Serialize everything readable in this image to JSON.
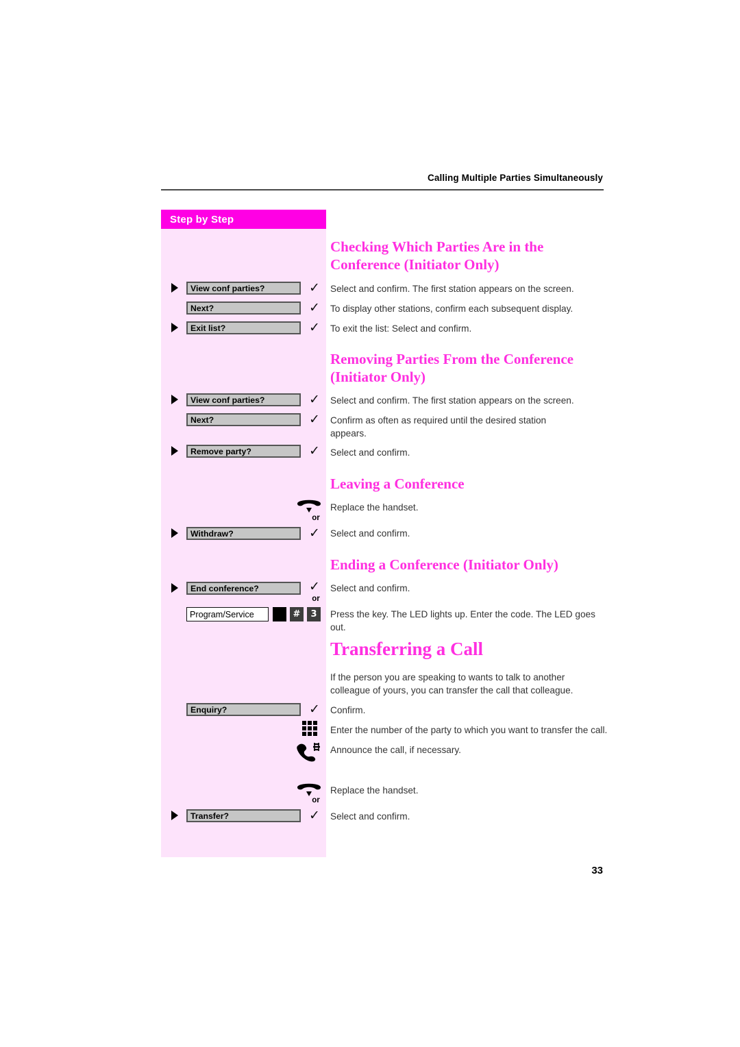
{
  "running_head": "Calling Multiple Parties Simultaneously",
  "sidebar": {
    "header_label": "Step by Step"
  },
  "page_number": "33",
  "colors": {
    "accent_magenta": "#ff00e4",
    "heading_magenta": "#ff2fe0",
    "sidebar_fill": "#fde3fb",
    "softkey_fill": "#c6c6c6",
    "softkey_border": "#555555"
  },
  "sections": [
    {
      "id": "checking-parties",
      "heading": "Checking Which Parties Are in the Conference (Initiator Only)",
      "steps": [
        {
          "bullet": true,
          "key_label": "View conf parties?",
          "icon": "check-icon",
          "text": "Select and confirm. The first station appears on the screen."
        },
        {
          "bullet": false,
          "key_label": "Next?",
          "icon": "check-icon",
          "text": "To display other stations, confirm each subsequent display."
        },
        {
          "bullet": true,
          "key_label": "Exit list?",
          "icon": "check-icon",
          "text": "To exit the list: Select and confirm."
        }
      ]
    },
    {
      "id": "removing-parties",
      "heading": "Removing Parties From the Conference (Initiator Only)",
      "steps": [
        {
          "bullet": true,
          "key_label": "View conf parties?",
          "icon": "check-icon",
          "text": "Select and confirm. The first station appears on the screen."
        },
        {
          "bullet": false,
          "key_label": "Next?",
          "icon": "check-icon",
          "text": "Confirm as often as required until the desired station appears."
        },
        {
          "bullet": true,
          "key_label": "Remove party?",
          "icon": "check-icon",
          "text": "Select and confirm."
        }
      ]
    },
    {
      "id": "leaving-conference",
      "heading": "Leaving a Conference",
      "steps": [
        {
          "bullet": false,
          "icon": "handset-down-icon",
          "text": "Replace the handset."
        },
        {
          "separator": "or"
        },
        {
          "bullet": true,
          "key_label": "Withdraw?",
          "icon": "check-icon",
          "text": "Select and confirm."
        }
      ]
    },
    {
      "id": "ending-conference",
      "heading": "Ending a Conference (Initiator Only)",
      "steps": [
        {
          "bullet": true,
          "key_label": "End conference?",
          "icon": "check-icon",
          "text": "Select and confirm."
        },
        {
          "separator": "or"
        },
        {
          "bullet": false,
          "feature_key_label": "Program/Service",
          "led": "led-indicator-icon",
          "code_keys": [
            "#",
            "3"
          ],
          "text": "Press the key. The LED lights up. Enter the code. The LED goes out."
        }
      ]
    },
    {
      "id": "transferring-a-call",
      "heading": "Transferring a Call",
      "intro": "If the person you are speaking to wants to talk to another colleague of yours, you can transfer the call that colleague.",
      "steps": [
        {
          "bullet": false,
          "key_label": "Enquiry?",
          "icon": "check-icon",
          "text": "Confirm."
        },
        {
          "bullet": false,
          "icon": "keypad-icon",
          "text": "Enter the number of the party to which you want to transfer the call."
        },
        {
          "bullet": false,
          "icon": "handset-announce-icon",
          "text": "Announce the call, if necessary."
        },
        {
          "bullet": false,
          "icon": "handset-down-icon",
          "text": "Replace the handset."
        },
        {
          "separator": "or"
        },
        {
          "bullet": true,
          "key_label": "Transfer?",
          "icon": "check-icon",
          "text": "Select and confirm."
        }
      ]
    }
  ]
}
